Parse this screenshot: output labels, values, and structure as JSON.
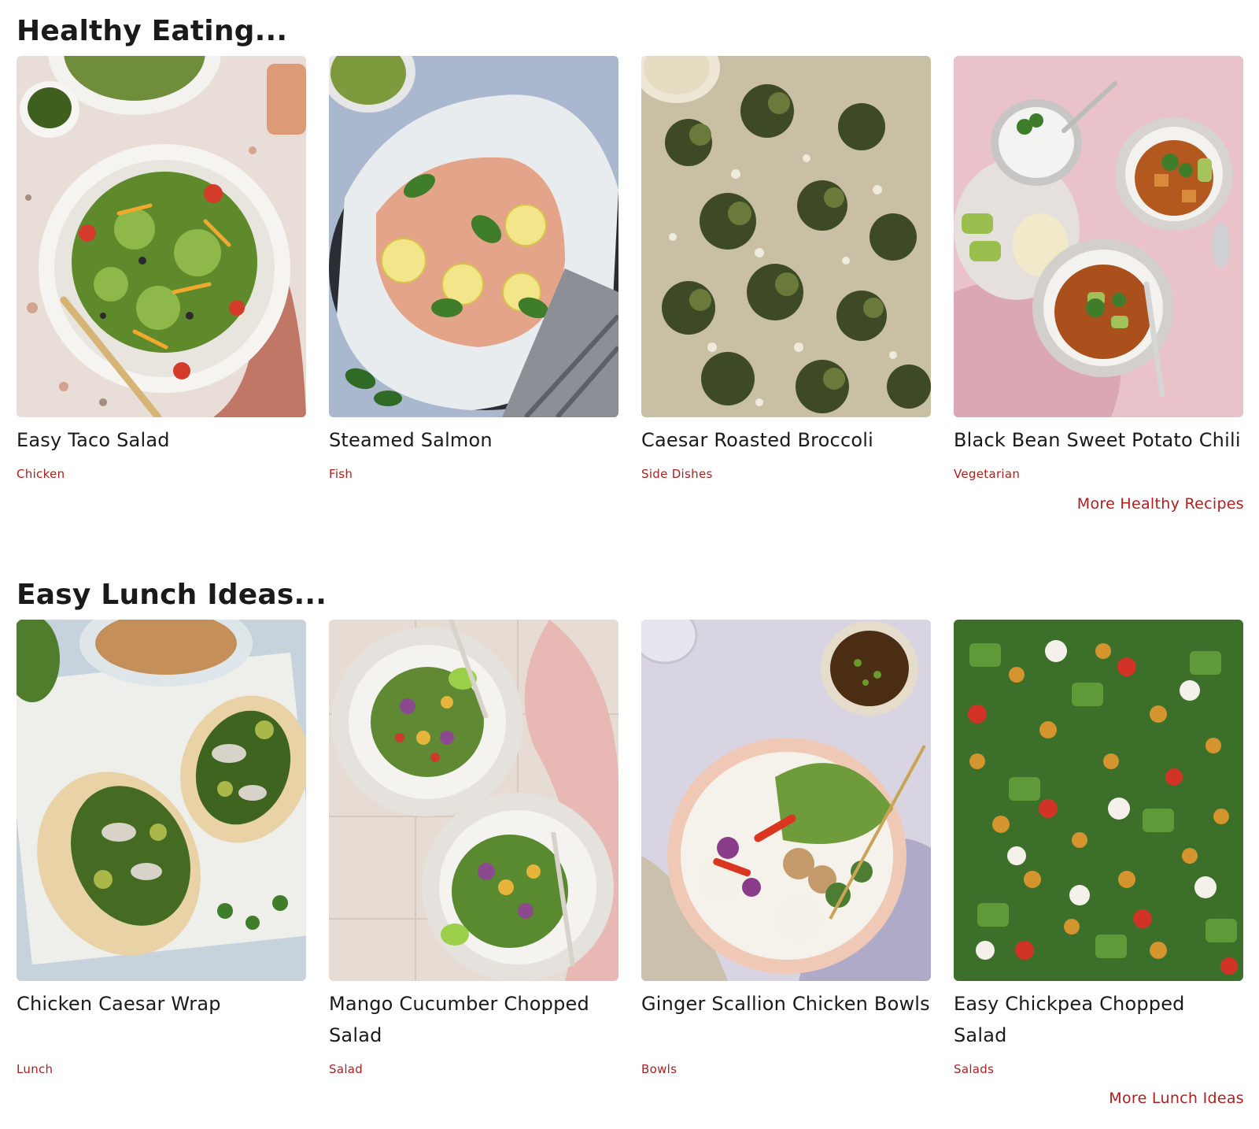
{
  "sections": [
    {
      "title": "Healthy Eating...",
      "more_link": "More Healthy Recipes",
      "cards": [
        {
          "title": "Easy Taco Salad",
          "tag": "Chicken"
        },
        {
          "title": "Steamed Salmon",
          "tag": "Fish"
        },
        {
          "title": "Caesar Roasted Broccoli",
          "tag": "Side Dishes"
        },
        {
          "title": "Black Bean Sweet Potato Chili",
          "tag": "Vegetarian"
        }
      ]
    },
    {
      "title": "Easy Lunch Ideas...",
      "more_link": "More Lunch Ideas",
      "cards": [
        {
          "title": "Chicken Caesar Wrap",
          "tag": "Lunch"
        },
        {
          "title": "Mango Cucumber Chopped Salad",
          "tag": "Salad"
        },
        {
          "title": "Ginger Scallion Chicken Bowls",
          "tag": "Bowls"
        },
        {
          "title": "Easy Chickpea Chopped Salad",
          "tag": "Salads"
        }
      ]
    }
  ],
  "colors": {
    "accent": "#b01e1e",
    "text": "#1a1a1a",
    "background": "#ffffff"
  }
}
